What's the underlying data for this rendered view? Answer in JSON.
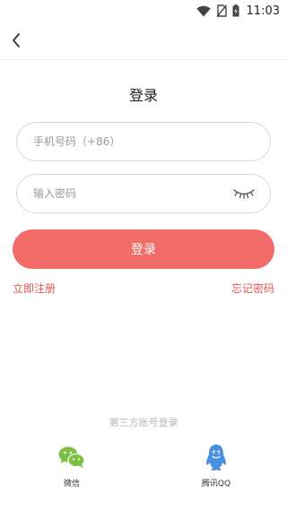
{
  "status_bar": {
    "time": "11:03",
    "icons": [
      "wifi-icon",
      "no-sim-icon",
      "battery-icon"
    ]
  },
  "nav": {
    "back_icon": "chevron-left-icon"
  },
  "title": "登录",
  "phone_input": {
    "placeholder": "手机号码（+86）",
    "value": ""
  },
  "password_input": {
    "placeholder": "输入密码",
    "value": "",
    "toggle_icon": "eye-closed-icon"
  },
  "login_button": {
    "label": "登录"
  },
  "links": {
    "register": "立即注册",
    "forgot_password": "忘记密码"
  },
  "third_party": {
    "label": "第三方账号登录",
    "options": [
      {
        "label": "微信",
        "icon": "wechat-icon"
      },
      {
        "label": "腾讯QQ",
        "icon": "qq-icon"
      }
    ]
  },
  "colors": {
    "accent": "#f26c6a",
    "link": "#e55451",
    "wechat": "#7bc043",
    "qq": "#4a90e2"
  }
}
